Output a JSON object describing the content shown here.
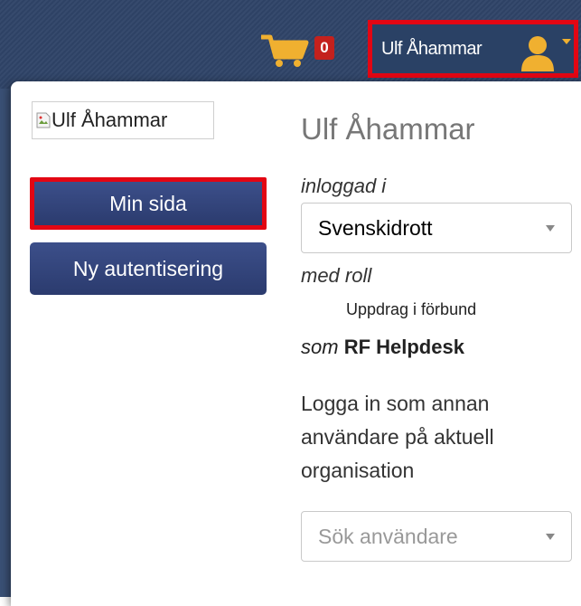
{
  "topbar": {
    "cart_count": "0",
    "user_name": "Ulf Åhammar"
  },
  "panel": {
    "avatar_alt": "Ulf Åhammar",
    "buttons": {
      "my_page": "Min sida",
      "new_auth": "Ny autentisering"
    },
    "name_heading": "Ulf Åhammar",
    "logged_in_label": "inloggad i",
    "organization_select": "Svenskidrott",
    "role_label": "med roll",
    "role_value": "Uppdrag i förbund",
    "as_label": "som",
    "as_value": "RF Helpdesk",
    "login_other_text": "Logga in som annan användare på aktuell organisation",
    "user_search_placeholder": "Sök användare"
  },
  "colors": {
    "topbar": "#2f4468",
    "highlight": "#e30613",
    "button": "#2b3b6e",
    "badge": "#c4211d",
    "cart": "#f0b030"
  }
}
